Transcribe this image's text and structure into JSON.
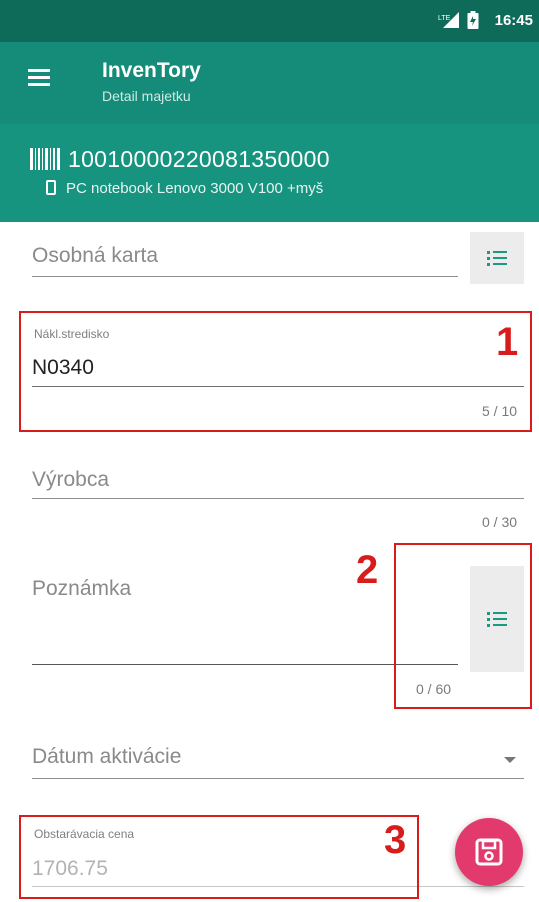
{
  "status_bar": {
    "network": "LTE",
    "time": "16:45"
  },
  "app_bar": {
    "title": "InvenTory",
    "subtitle": "Detail majetku",
    "menu_icon": "hamburger-menu-icon"
  },
  "asset": {
    "code": "10010000220081350000",
    "name": "PC notebook Lenovo 3000 V100 +myš",
    "code_icon": "barcode-icon",
    "name_icon": "clipboard-icon"
  },
  "form": {
    "osobna_karta": {
      "placeholder": "Osobná karta",
      "button_icon": "list-icon"
    },
    "nakl_stredisko": {
      "label": "Nákl.stredisko",
      "value": "N0340",
      "counter": "5 / 10"
    },
    "vyrobca": {
      "placeholder": "Výrobca",
      "counter": "0 / 30"
    },
    "poznamka": {
      "placeholder": "Poznámka",
      "counter": "0 / 60",
      "button_icon": "list-icon"
    },
    "datum_aktivacie": {
      "placeholder": "Dátum aktivácie",
      "dropdown_icon": "chevron-down-icon"
    },
    "obstaravacia_cena": {
      "label": "Obstarávacia cena",
      "value": "1706.75"
    }
  },
  "annotations": [
    "1",
    "2",
    "3"
  ],
  "fab": {
    "icon": "save-icon"
  },
  "colors": {
    "status_bar": "#0e6b5a",
    "app_bar": "#158c79",
    "asset_header": "#16947f",
    "accent": "#1a9a84",
    "fab": "#e33a6e",
    "annotation": "#d81b1b"
  }
}
